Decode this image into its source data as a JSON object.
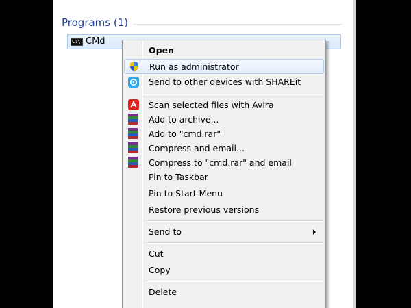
{
  "start_menu": {
    "section_header": "Programs (1)",
    "result_item_label": "CMd",
    "cmd_icon_text": "C:\\"
  },
  "context_menu": {
    "items": [
      {
        "label": "Open",
        "icon": null,
        "bold": true
      },
      {
        "label": "Run as administrator",
        "icon": "uac-shield-icon",
        "highlighted": true
      },
      {
        "label": "Send to other devices with SHAREit",
        "icon": "shareit-icon"
      },
      {
        "label": "Scan selected files with Avira",
        "icon": "avira-icon"
      },
      {
        "label": "Add to archive...",
        "icon": "winrar-icon"
      },
      {
        "label": "Add to \"cmd.rar\"",
        "icon": "winrar-icon"
      },
      {
        "label": "Compress and email...",
        "icon": "winrar-icon"
      },
      {
        "label": "Compress to \"cmd.rar\" and email",
        "icon": "winrar-icon"
      },
      {
        "label": "Pin to Taskbar",
        "icon": null
      },
      {
        "label": "Pin to Start Menu",
        "icon": null
      },
      {
        "label": "Restore previous versions",
        "icon": null
      },
      {
        "label": "Send to",
        "icon": null,
        "submenu": true
      },
      {
        "label": "Cut",
        "icon": null
      },
      {
        "label": "Copy",
        "icon": null
      },
      {
        "label": "Delete",
        "icon": null
      }
    ]
  },
  "colors": {
    "header_blue": "#1e3f8a",
    "selection_border": "#a8c8f0",
    "menu_background": "#f0f0f0",
    "page_background": "#000000"
  }
}
